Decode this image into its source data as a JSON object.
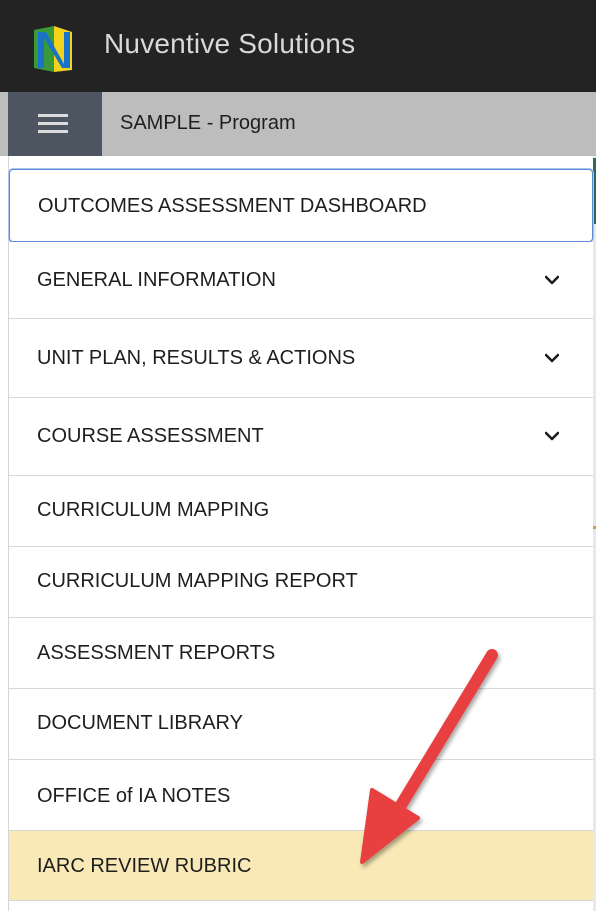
{
  "header": {
    "brand": "Nuventive Solutions",
    "logo_icon": "nuventive-logo-icon",
    "background_color": "#232323"
  },
  "subbar": {
    "menu_icon": "hamburger-menu-icon",
    "breadcrumb": "SAMPLE - Program"
  },
  "menu": {
    "items": [
      {
        "label": "OUTCOMES ASSESSMENT DASHBOARD",
        "expandable": false,
        "state": "focused"
      },
      {
        "label": "GENERAL INFORMATION",
        "expandable": true,
        "icon": "chevron-down-icon"
      },
      {
        "label": "UNIT PLAN, RESULTS & ACTIONS",
        "expandable": true,
        "icon": "chevron-down-icon"
      },
      {
        "label": "COURSE ASSESSMENT",
        "expandable": true,
        "icon": "chevron-down-icon"
      },
      {
        "label": "CURRICULUM MAPPING",
        "expandable": false
      },
      {
        "label": "CURRICULUM MAPPING REPORT",
        "expandable": false
      },
      {
        "label": "ASSESSMENT REPORTS",
        "expandable": false
      },
      {
        "label": "DOCUMENT LIBRARY",
        "expandable": false
      },
      {
        "label": "OFFICE of IA NOTES",
        "expandable": false
      },
      {
        "label": "IARC REVIEW RUBRIC",
        "expandable": false,
        "state": "highlighted"
      }
    ],
    "highlight_color": "#f8e9b6",
    "focus_color": "#5b8bd6"
  },
  "annotation": {
    "arrow_icon": "red-arrow-icon",
    "arrow_color": "#e8403f"
  }
}
